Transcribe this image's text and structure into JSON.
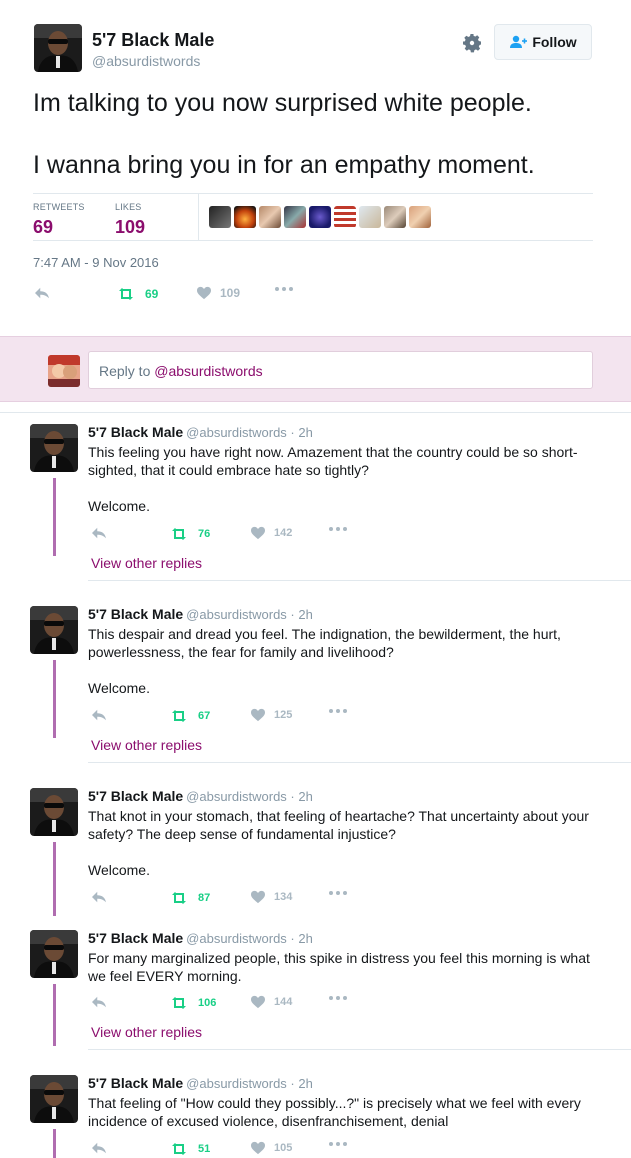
{
  "tweet": {
    "name": "5'7 Black Male",
    "handle": "@absurdistwords",
    "follow_label": "Follow",
    "text_line1": "Im talking to you now surprised white people.",
    "text_line2": "I wanna bring you in for an empathy moment.",
    "retweets_label": "RETWEETS",
    "retweets": "69",
    "likes_label": "LIKES",
    "likes": "109",
    "timestamp": "7:47 AM - 9 Nov 2016",
    "actions": {
      "retweets": "69",
      "likes": "109"
    }
  },
  "reply_box": {
    "prefix": "Reply to ",
    "mention": "@absurdistwords"
  },
  "replies": [
    {
      "name": "5'7 Black Male",
      "handle": "@absurdistwords · 2h",
      "body1": "This feeling you have right now. Amazement that the country could be so short-sighted, that it could embrace hate so tightly?",
      "body2": "Welcome.",
      "retweets": "76",
      "likes": "142",
      "view_replies": "View other replies"
    },
    {
      "name": "5'7 Black Male",
      "handle": "@absurdistwords · 2h",
      "body1": "This despair and dread you feel. The indignation,  the bewilderment, the hurt, powerlessness, the fear for family and livelihood?",
      "body2": "Welcome.",
      "retweets": "67",
      "likes": "125",
      "view_replies": "View other replies"
    },
    {
      "name": "5'7 Black Male",
      "handle": "@absurdistwords · 2h",
      "body1": "That knot in your stomach, that feeling of heartache? That uncertainty about your safety? The deep sense of fundamental injustice?",
      "body2": "Welcome.",
      "retweets": "87",
      "likes": "134"
    },
    {
      "name": "5'7 Black Male",
      "handle": "@absurdistwords · 2h",
      "body1": "For many marginalized people, this spike in distress you feel this morning is what we feel EVERY morning.",
      "retweets": "106",
      "likes": "144",
      "view_replies": "View other replies"
    },
    {
      "name": "5'7 Black Male",
      "handle": "@absurdistwords · 2h",
      "body1": "That feeling of \"How could they possibly...?\" is precisely what we feel with every incidence of excused violence, disenfranchisement, denial",
      "retweets": "51",
      "likes": "105"
    }
  ],
  "colors": {
    "accent": "#8b0d6d",
    "retweet_green": "#19cf86",
    "thread_line": "#b06db0",
    "reply_bg": "#f3e4ef"
  },
  "icons": [
    "gear-icon",
    "follow-person-icon",
    "reply-icon",
    "retweet-icon",
    "heart-icon",
    "more-icon"
  ]
}
